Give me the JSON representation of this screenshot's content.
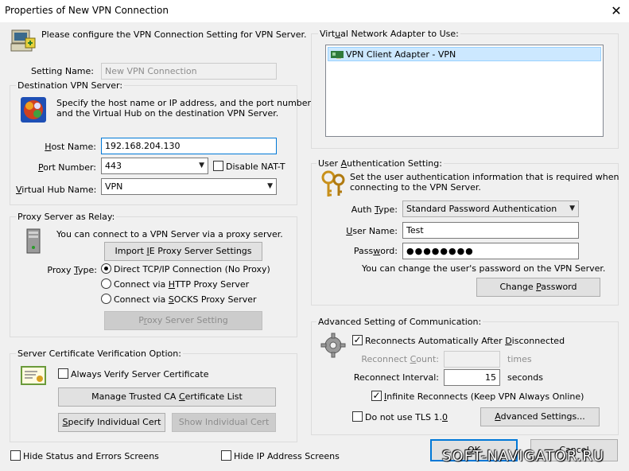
{
  "window": {
    "title": "Properties of New VPN Connection"
  },
  "intro": "Please configure the VPN Connection Setting for VPN Server.",
  "setting_name": {
    "label": "Setting Name:",
    "value": "New VPN Connection"
  },
  "destination": {
    "group_title": "Destination VPN Server:",
    "description_line1": "Specify the host name or IP address, and the port number",
    "description_line2": "and the Virtual Hub on the destination VPN Server.",
    "host_label": "Host Name:",
    "host_value": "192.168.204.130",
    "port_label": "Port Number:",
    "port_value": "443",
    "disable_nat_label": "Disable NAT-T",
    "hub_label": "Virtual Hub Name:",
    "hub_value": "VPN"
  },
  "proxy": {
    "group_title": "Proxy Server as Relay:",
    "description": "You can connect to a VPN Server via a proxy server.",
    "import_button": "Import IE Proxy Server Settings",
    "type_label": "Proxy Type:",
    "options": [
      "Direct TCP/IP Connection (No Proxy)",
      "Connect via HTTP Proxy Server",
      "Connect via SOCKS Proxy Server"
    ],
    "setting_button": "Proxy Server Setting"
  },
  "certificate": {
    "group_title": "Server Certificate Verification Option:",
    "always_verify_label": "Always Verify Server Certificate",
    "manage_button": "Manage Trusted CA Certificate List",
    "specify_button": "Specify Individual Cert",
    "show_button": "Show Individual Cert"
  },
  "adapter": {
    "group_title": "Virtual Network Adapter to Use:",
    "items": [
      "VPN Client Adapter - VPN"
    ]
  },
  "auth": {
    "group_title": "User Authentication Setting:",
    "description_line1": "Set the user authentication information that is required when",
    "description_line2": "connecting to the VPN Server.",
    "type_label": "Auth Type:",
    "type_value": "Standard Password Authentication",
    "user_label": "User Name:",
    "user_value": "Test",
    "password_label": "Password:",
    "password_value": "●●●●●●●●",
    "note": "You can change the user's password on the VPN Server.",
    "change_button": "Change Password"
  },
  "advanced": {
    "group_title": "Advanced Setting of Communication:",
    "reconnect_auto_label": "Reconnects Automatically After Disconnected",
    "reconnect_count_label": "Reconnect Count:",
    "reconnect_count_value": "",
    "times_label": "times",
    "interval_label": "Reconnect Interval:",
    "interval_value": "15",
    "seconds_label": "seconds",
    "infinite_label": "Infinite Reconnects (Keep VPN Always Online)",
    "no_tls_label": "Do not use TLS 1.0",
    "advanced_button": "Advanced Settings..."
  },
  "bottom": {
    "hide_status_label": "Hide Status and Errors Screens",
    "hide_ip_label": "Hide IP Address Screens",
    "ok_button": "OK",
    "cancel_button": "Cancel"
  },
  "watermark": "SOFT-NAVIGATOR.RU"
}
